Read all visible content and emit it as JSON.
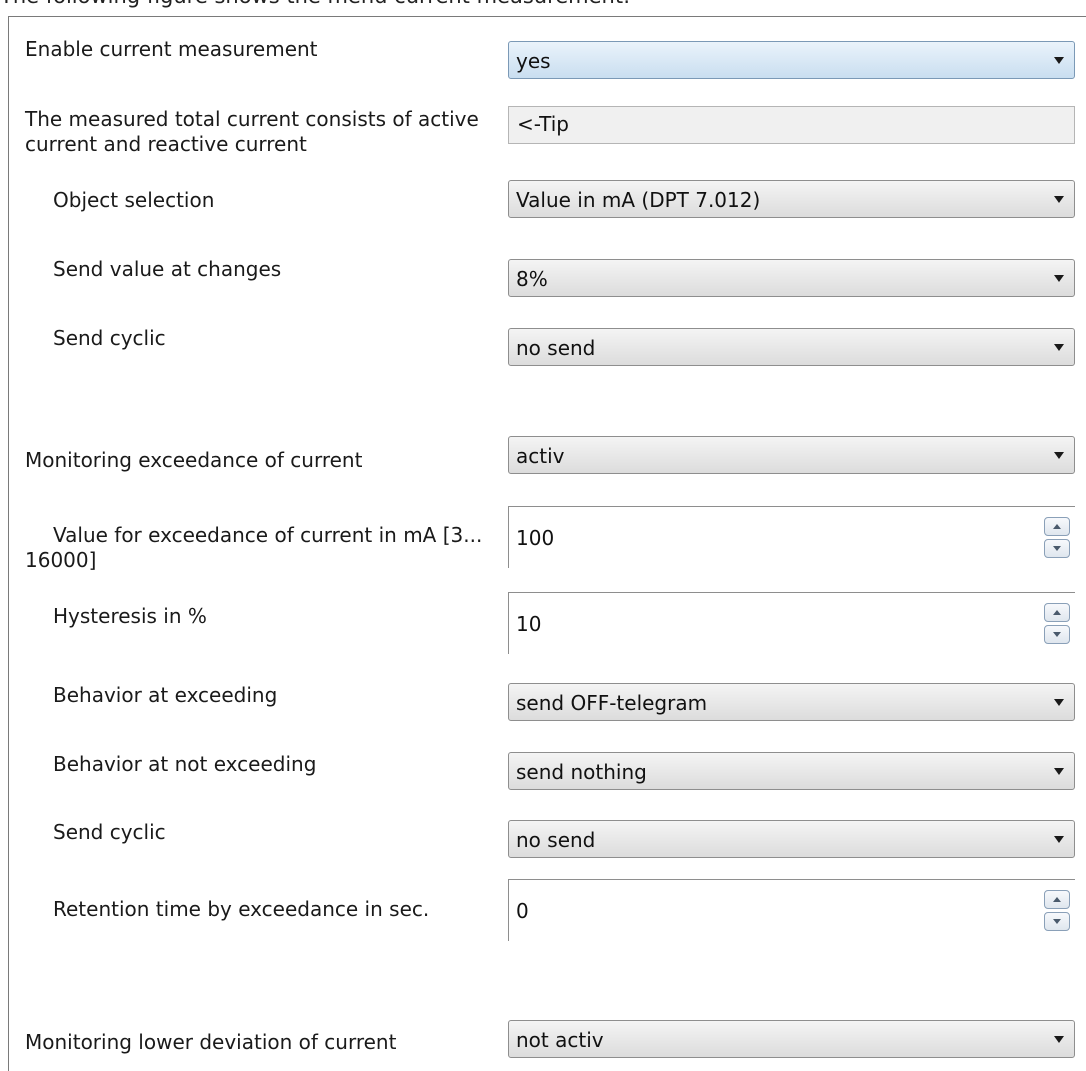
{
  "caption": "The following figure shows the menu current measurement:",
  "rows": [
    {
      "label": "Enable current measurement",
      "value": "yes"
    },
    {
      "label": "The measured total current consists of active current and reactive current",
      "value": "<-Tip"
    },
    {
      "label": "Object selection",
      "value": "Value in mA (DPT 7.012)"
    },
    {
      "label": "Send value at changes",
      "value": "8%"
    },
    {
      "label": "Send cyclic",
      "value": "no send"
    },
    {
      "label": "Monitoring exceedance of current",
      "value": "activ"
    },
    {
      "label": "Value for exceedance of current in mA [3... 16000]",
      "value": "100"
    },
    {
      "label": "Hysteresis in %",
      "value": "10"
    },
    {
      "label": "Behavior at exceeding",
      "value": "send OFF-telegram"
    },
    {
      "label": "Behavior at not exceeding",
      "value": "send nothing"
    },
    {
      "label": "Send cyclic",
      "value": "no send"
    },
    {
      "label": "Retention time by exceedance in sec.",
      "value": "0"
    },
    {
      "label": "Monitoring lower deviation of current",
      "value": "not activ"
    }
  ],
  "icons": {
    "dropdown": "chevron-down-icon",
    "spin_up": "spin-up-icon",
    "spin_down": "spin-down-icon"
  },
  "colors": {
    "highlight_combo": "#c9def0",
    "combo": "#dcdcdc",
    "readonly": "#f0f0f0"
  }
}
